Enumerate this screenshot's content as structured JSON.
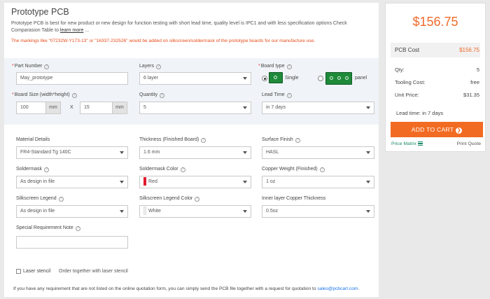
{
  "intro": {
    "title": "Prototype PCB",
    "description": "Prototype PCB is best for new product or new design for function testing with short lead time, quality level is IPC1 and with less specification options Check Comparasion Table to",
    "learn_more": "learn more",
    "warning": "The markings like \"07232W-Y173-13\" or \"16337-232526\" would be added on silkscreen/soldermask of the prototype boards for our manufacture use."
  },
  "form": {
    "part_number": {
      "label": "Part Number",
      "value": "May_prototype"
    },
    "layers": {
      "label": "Layers",
      "value": "6 layer"
    },
    "board_type": {
      "label": "Board type",
      "single": "Single",
      "panel": "panel"
    },
    "board_size": {
      "label": "Board Size (width*height)",
      "width": "100",
      "height": "15",
      "unit": "mm",
      "times": "X"
    },
    "quantity": {
      "label": "Quantity",
      "value": "5"
    },
    "lead_time": {
      "label": "Lead Time",
      "value": "in 7 days"
    },
    "material": {
      "label": "Material Details",
      "value": "FR4-Standard Tg 140C"
    },
    "thickness": {
      "label": "Thickness (Finished Board)",
      "value": "1.6 mm"
    },
    "surface": {
      "label": "Surface Finish",
      "value": "HASL"
    },
    "soldermask": {
      "label": "Soldermask",
      "value": "As design in file"
    },
    "soldermask_color": {
      "label": "Soldermask Color",
      "value": "Red"
    },
    "copper_weight": {
      "label": "Copper Weight (Finished)",
      "value": "1 oz"
    },
    "silkscreen": {
      "label": "Silkscreen Legend",
      "value": "As design in file"
    },
    "silkscreen_color": {
      "label": "Silkscreen Legend Color",
      "value": "White"
    },
    "inner_copper": {
      "label": "Inner layer Copper Thickness",
      "value": "0.5oz"
    },
    "special_note": {
      "label": "Special Requirement Note",
      "value": ""
    },
    "laser_stencil": {
      "label": "Laser stencil",
      "note": "Order together with laser stencil"
    }
  },
  "footer": {
    "note": "If you have any requirement that are not listed on the online quotation form, you can simply send the PCB file together with a request for quotation to",
    "email": "sales@pcbcart.com",
    "period": "."
  },
  "summary": {
    "total": "$156.75",
    "pcb_cost_label": "PCB Cost",
    "pcb_cost_value": "$156.75",
    "qty_label": "Qty:",
    "qty_value": "5",
    "tooling_label": "Tooling Cost:",
    "tooling_value": "free",
    "unit_label": "Unit Price:",
    "unit_value": "$31.35",
    "lead_time": "Lead time: in 7 days",
    "add_to_cart": "ADD TO CART",
    "price_matrix": "Price Matrix",
    "print_quote": "Print Quote"
  },
  "colors": {
    "accent": "#f26b22",
    "price": "#f06a2b",
    "warning": "#e64a19",
    "link": "#1b8b6a"
  },
  "icons": {
    "help": "question-circle-icon",
    "dropdown": "chevron-down-icon",
    "cart_go": "arrow-right-circle-icon",
    "matrix": "list-icon"
  }
}
